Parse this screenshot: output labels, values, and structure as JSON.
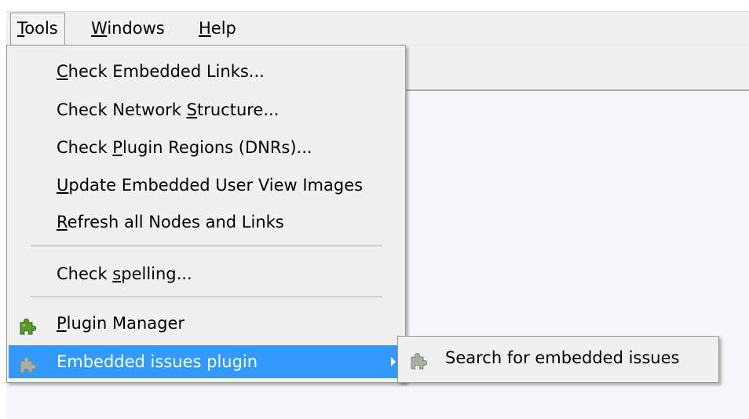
{
  "menubar": {
    "items": [
      {
        "id": "tools",
        "pre": "",
        "key": "T",
        "post": "ools"
      },
      {
        "id": "windows",
        "pre": "",
        "key": "W",
        "post": "indows"
      },
      {
        "id": "help",
        "pre": "",
        "key": "H",
        "post": "elp"
      }
    ]
  },
  "tools_menu": {
    "items": [
      {
        "id": "check-embedded-links",
        "pre": "",
        "key": "C",
        "post": "heck Embedded Links..."
      },
      {
        "id": "check-network-structure",
        "pre": "Check Network ",
        "key": "S",
        "post": "tructure..."
      },
      {
        "id": "check-plugin-regions",
        "pre": "Check ",
        "key": "P",
        "post": "lugin Regions (DNRs)..."
      },
      {
        "id": "update-embedded-user-view-images",
        "pre": "",
        "key": "U",
        "post": "pdate Embedded User View Images"
      },
      {
        "id": "refresh-all-nodes-and-links",
        "pre": "",
        "key": "R",
        "post": "efresh all Nodes and Links"
      },
      {
        "id": "check-spelling",
        "pre": "Check ",
        "key": "s",
        "post": "pelling..."
      },
      {
        "id": "plugin-manager",
        "pre": "",
        "key": "P",
        "post": "lugin Manager",
        "icon": "puzzle-piece-green-icon"
      },
      {
        "id": "embedded-issues-plugin",
        "pre": "",
        "key": "",
        "post": "Embedded issues plugin",
        "icon": "puzzle-piece-gray-icon",
        "highlighted": true
      }
    ]
  },
  "submenu": {
    "items": [
      {
        "id": "search-for-embedded-issues",
        "label": "Search for embedded issues",
        "icon": "puzzle-piece-gray-icon"
      }
    ]
  },
  "colors": {
    "highlight": "#3399ff",
    "menu_bg": "#f0f0f0",
    "plugin_icon_green": "#5a9a2a",
    "plugin_icon_gray": "#a8b0a4"
  }
}
